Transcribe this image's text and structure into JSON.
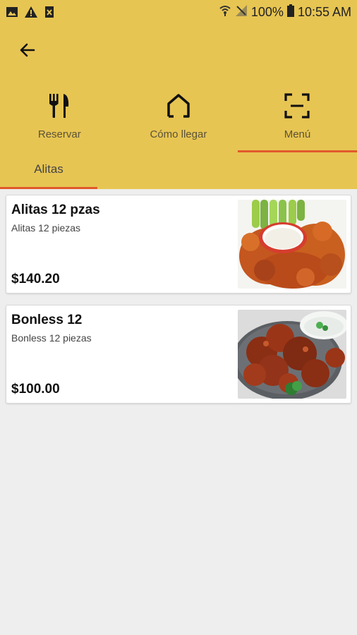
{
  "status_bar": {
    "battery": "100%",
    "time": "10:55 AM",
    "icons": [
      "image-icon",
      "warning-icon",
      "file-icon",
      "wifi-icon",
      "signal-icon",
      "battery-icon"
    ]
  },
  "header": {
    "back_icon": "arrow-left-icon",
    "nav": [
      {
        "label": "Reservar",
        "icon": "utensils-icon"
      },
      {
        "label": "Cómo llegar",
        "icon": "home-icon"
      },
      {
        "label": "Menú",
        "icon": "scan-icon",
        "active": true
      }
    ],
    "tabs": [
      {
        "label": "Alitas",
        "active": true
      }
    ]
  },
  "items": [
    {
      "title": "Alitas 12 pzas",
      "description": "Alitas 12 piezas",
      "price": "$140.20"
    },
    {
      "title": "Bonless 12",
      "description": "Bonless 12 piezas",
      "price": "$100.00"
    }
  ],
  "colors": {
    "header_bg": "#e7c553",
    "accent": "#e05a2b",
    "page_bg": "#eeeeee"
  }
}
